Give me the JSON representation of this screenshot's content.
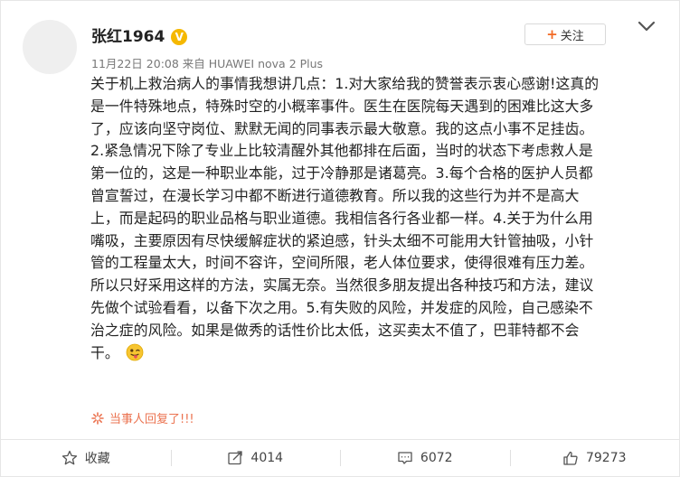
{
  "post": {
    "author": {
      "username": "张红1964",
      "verified_badge": "V",
      "avatar_icon": "avatar-placeholder"
    },
    "meta": "11月22日 20:08 来自 HUAWEI nova 2 Plus",
    "follow_label": "关注",
    "follow_plus": "+",
    "content_lines": [
      "关于机上救治病人的事情我想讲几点：1.对大家给我的赞誉表示衷心感谢!这真的",
      "是一件特殊地点，特殊时空的小概率事件。医生在医院每天遇到的困难比这大多",
      "了，应该向坚守岗位、默默无闻的同事表示最大敬意。我的这点小事不足挂齿。",
      "2.紧急情况下除了专业上比较清醒外其他都排在后面，当时的状态下考虑救人是",
      "第一位的，这是一种职业本能，过于冷静那是诸葛亮。3.每个合格的医护人员都",
      "曾宣誓过，在漫长学习中都不断进行道德教育。所以我的这些行为并不是高大",
      "上，而是起码的职业品格与职业道德。我相信各行各业都一样。4.关于为什么用",
      "嘴吸，主要原因有尽快缓解症状的紧迫感，针头太细不可能用大针管抽吸，小针",
      "管的工程量太大，时间不容许，空间所限，老人体位要求，使得很难有压力差。",
      "所以只好采用这样的方法，实属无奈。当然很多朋友提出各种技巧和方法，建议",
      "先做个试验看看，以备下次之用。5.有失败的风险，并发症的风险，自己感染不",
      "治之症的风险。如果是做秀的话性价比太低，这买卖太不值了，巴菲特都不会",
      "干。"
    ],
    "emoji_icon": "tongue-out-emoji",
    "reply_notice": "当事人回复了!!!",
    "actions": {
      "favorite_label": "收藏",
      "repost_count": "4014",
      "comment_count": "6072",
      "like_count": "79273"
    }
  },
  "colors": {
    "accent": "#f26a25",
    "reply": "#eb7350",
    "badge": "#f5b800"
  }
}
